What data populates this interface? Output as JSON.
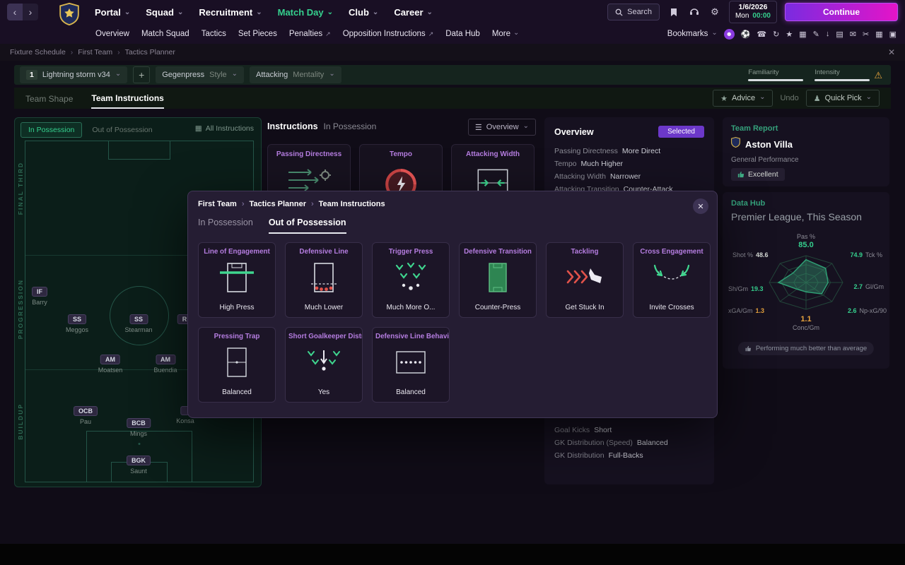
{
  "topbar": {
    "menu": [
      {
        "label": "Portal"
      },
      {
        "label": "Squad"
      },
      {
        "label": "Recruitment"
      },
      {
        "label": "Match Day"
      },
      {
        "label": "Club"
      },
      {
        "label": "Career"
      }
    ],
    "search_label": "Search",
    "date": "1/6/2026",
    "day": "Mon",
    "time": "00:00",
    "continue_label": "Continue"
  },
  "subnav": {
    "items": [
      "Overview",
      "Match Squad",
      "Tactics",
      "Set Pieces",
      "Penalties",
      "Opposition Instructions",
      "Data Hub",
      "More"
    ],
    "bookmarks_label": "Bookmarks",
    "icons": [
      {
        "name": "profile",
        "glyph": "☻"
      },
      {
        "name": "football",
        "glyph": "⚽"
      },
      {
        "name": "phone",
        "glyph": "☎"
      },
      {
        "name": "refresh",
        "glyph": "↻"
      },
      {
        "name": "awards",
        "glyph": "★"
      },
      {
        "name": "screen",
        "glyph": "▦"
      },
      {
        "name": "notes",
        "glyph": "✎"
      },
      {
        "name": "download",
        "glyph": "↓"
      },
      {
        "name": "list",
        "glyph": "▤"
      },
      {
        "name": "mail",
        "glyph": "✉"
      },
      {
        "name": "cut",
        "glyph": "✂"
      },
      {
        "name": "calendar",
        "glyph": "▦"
      },
      {
        "name": "device",
        "glyph": "▣"
      }
    ]
  },
  "breadcrumb": {
    "items": [
      "Fixture Schedule",
      "First Team",
      "Tactics Planner"
    ]
  },
  "tacticbar": {
    "slot": "1",
    "name": "Lightning storm v34",
    "add": "+",
    "style_value": "Gegenpress",
    "style_label": "Style",
    "mentality_value": "Attacking",
    "mentality_label": "Mentality",
    "familiarity_label": "Familiarity",
    "intensity_label": "Intensity"
  },
  "tabs": {
    "shape": "Team Shape",
    "instructions": "Team Instructions",
    "advice": "Advice",
    "undo": "Undo",
    "quick_pick": "Quick Pick"
  },
  "pitch": {
    "in_possession": "In Possession",
    "out_of_possession": "Out of Possession",
    "all_instructions": "All Instructions",
    "zones": [
      "FINAL THIRD",
      "PROGRESSION",
      "BUILDUP"
    ],
    "players": [
      {
        "role": "IF",
        "name": "Barry"
      },
      {
        "role": "SS",
        "name": "Meggos"
      },
      {
        "role": "SS",
        "name": "Stearman"
      },
      {
        "role": "R",
        "name": ""
      },
      {
        "role": "AM",
        "name": "Moatsen"
      },
      {
        "role": "AM",
        "name": "Buendia"
      },
      {
        "role": "OCB",
        "name": "Pau"
      },
      {
        "role": "BCB",
        "name": "Mings"
      },
      {
        "role": "",
        "name": "Konsa"
      },
      {
        "role": "BGK",
        "name": "Saunt"
      }
    ]
  },
  "instructions": {
    "title": "Instructions",
    "subtitle": "In Possession",
    "view": "Overview",
    "cards": [
      {
        "title": "Passing Directness"
      },
      {
        "title": "Tempo"
      },
      {
        "title": "Attacking Width"
      }
    ]
  },
  "overview": {
    "title": "Overview",
    "selected_label": "Selected",
    "top_items": [
      {
        "label": "Passing Directness",
        "value": "More Direct"
      },
      {
        "label": "Tempo",
        "value": "Much Higher"
      },
      {
        "label": "Attacking Width",
        "value": "Narrower"
      },
      {
        "label": "Attacking Transition",
        "value": "Counter-Attack"
      }
    ],
    "bottom_items": [
      {
        "label": "Goal Kicks",
        "value": "Short"
      },
      {
        "label": "GK Distribution (Speed)",
        "value": "Balanced"
      },
      {
        "label": "GK Distribution",
        "value": "Full-Backs"
      }
    ]
  },
  "modal": {
    "breadcrumb": [
      "First Team",
      "Tactics Planner",
      "Team Instructions"
    ],
    "tab_in": "In Possession",
    "tab_out": "Out of Possession",
    "cards": [
      {
        "title": "Line of Engagement",
        "value": "High Press"
      },
      {
        "title": "Defensive Line",
        "value": "Much Lower"
      },
      {
        "title": "Trigger Press",
        "value": "Much More O..."
      },
      {
        "title": "Defensive Transition",
        "value": "Counter-Press"
      },
      {
        "title": "Tackling",
        "value": "Get Stuck In"
      },
      {
        "title": "Cross Engagement",
        "value": "Invite Crosses"
      },
      {
        "title": "Pressing Trap",
        "value": "Balanced"
      },
      {
        "title": "Short Goalkeeper Distr",
        "value": "Yes"
      },
      {
        "title": "Defensive Line Behavio",
        "value": "Balanced"
      }
    ]
  },
  "team_report": {
    "title": "Team Report",
    "team": "Aston Villa",
    "section": "General Performance",
    "rating": "Excellent"
  },
  "data_hub": {
    "title": "Data Hub",
    "subtitle": "Premier League, This Season",
    "radar": [
      {
        "label": "Pas %",
        "value": "85.0",
        "tone": "green"
      },
      {
        "label": "Shot %",
        "value": "48.6",
        "tone": "white"
      },
      {
        "label": "Tck %",
        "value": "74.9",
        "tone": "green"
      },
      {
        "label": "Sh/Gm",
        "value": "19.3",
        "tone": "green"
      },
      {
        "label": "Gl/Gm",
        "value": "2.7",
        "tone": "green"
      },
      {
        "label": "xGA/Gm",
        "value": "1.3",
        "tone": "orange"
      },
      {
        "label": "Np-xG/90",
        "value": "2.6",
        "tone": "green"
      },
      {
        "label": "Conc/Gm",
        "value": "1.1",
        "tone": "orange"
      }
    ],
    "footer": "Performing much better than average"
  },
  "colors": {
    "accent_green": "#35d08e",
    "accent_purple": "#b57de0",
    "warn_orange": "#e8a33d",
    "continue_gradient_start": "#7a2be0",
    "continue_gradient_end": "#e414c8"
  }
}
